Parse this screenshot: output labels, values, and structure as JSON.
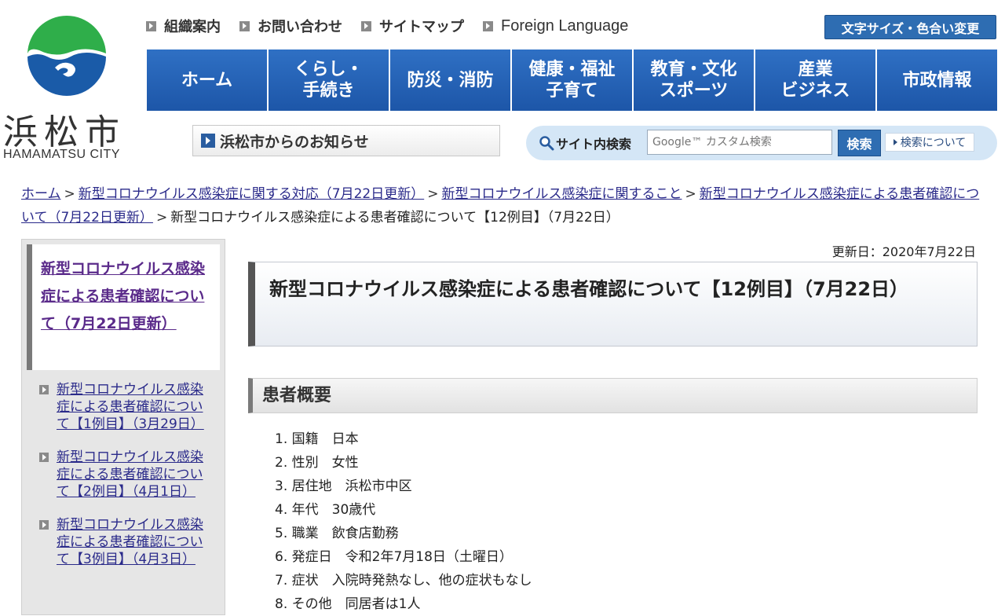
{
  "logo": {
    "kanji": "浜松市",
    "roman": "HAMAMATSU CITY"
  },
  "util_nav": [
    {
      "label": "組織案内"
    },
    {
      "label": "お問い合わせ"
    },
    {
      "label": "サイトマップ"
    },
    {
      "label": "Foreign Language"
    }
  ],
  "size_color_button": "文字サイズ・色合い変更",
  "global_nav": [
    {
      "label": "ホーム"
    },
    {
      "label": "くらし・\n手続き"
    },
    {
      "label": "防災・消防"
    },
    {
      "label": "健康・福祉\n子育て"
    },
    {
      "label": "教育・文化\nスポーツ"
    },
    {
      "label": "産業\nビジネス"
    },
    {
      "label": "市政情報"
    }
  ],
  "notice_link": "浜松市からのお知らせ",
  "search": {
    "label": "サイト内検索",
    "placeholder": "Google™ カスタム検索",
    "button": "検索",
    "help": "検索について"
  },
  "breadcrumb": {
    "links": [
      "ホーム",
      "新型コロナウイルス感染症に関する対応（7月22日更新）",
      "新型コロナウイルス感染症に関すること",
      "新型コロナウイルス感染症による患者確認について（7月22日更新）"
    ],
    "separator": ">",
    "current": "新型コロナウイルス感染症による患者確認について【12例目】（7月22日）"
  },
  "sidebar": {
    "heading": "新型コロナウイルス感染症による患者確認について（7月22日更新）",
    "items": [
      {
        "label": "新型コロナウイルス感染症による患者確認について【1例目】（3月29日）"
      },
      {
        "label": "新型コロナウイルス感染症による患者確認について【2例目】（4月1日）"
      },
      {
        "label": "新型コロナウイルス感染症による患者確認について【3例目】（4月3日）"
      }
    ]
  },
  "main": {
    "updated": "更新日：2020年7月22日",
    "title": "新型コロナウイルス感染症による患者確認について【12例目】（7月22日）",
    "section_heading": "患者概要",
    "facts": [
      "1. 国籍　日本",
      "2. 性別　女性",
      "3. 居住地　浜松市中区",
      "4. 年代　30歳代",
      "5. 職業　飲食店勤務",
      "6. 発症日　令和2年7月18日（土曜日）",
      "7. 症状　入院時発熱なし、他の症状もなし",
      "8. その他　同居者は1人"
    ]
  },
  "colors": {
    "nav_blue": "#2f70c4",
    "logo_green": "#2fae4a",
    "logo_blue": "#1a5ba8",
    "link": "#2a2a8a",
    "visited_link": "#5a2a8a"
  }
}
